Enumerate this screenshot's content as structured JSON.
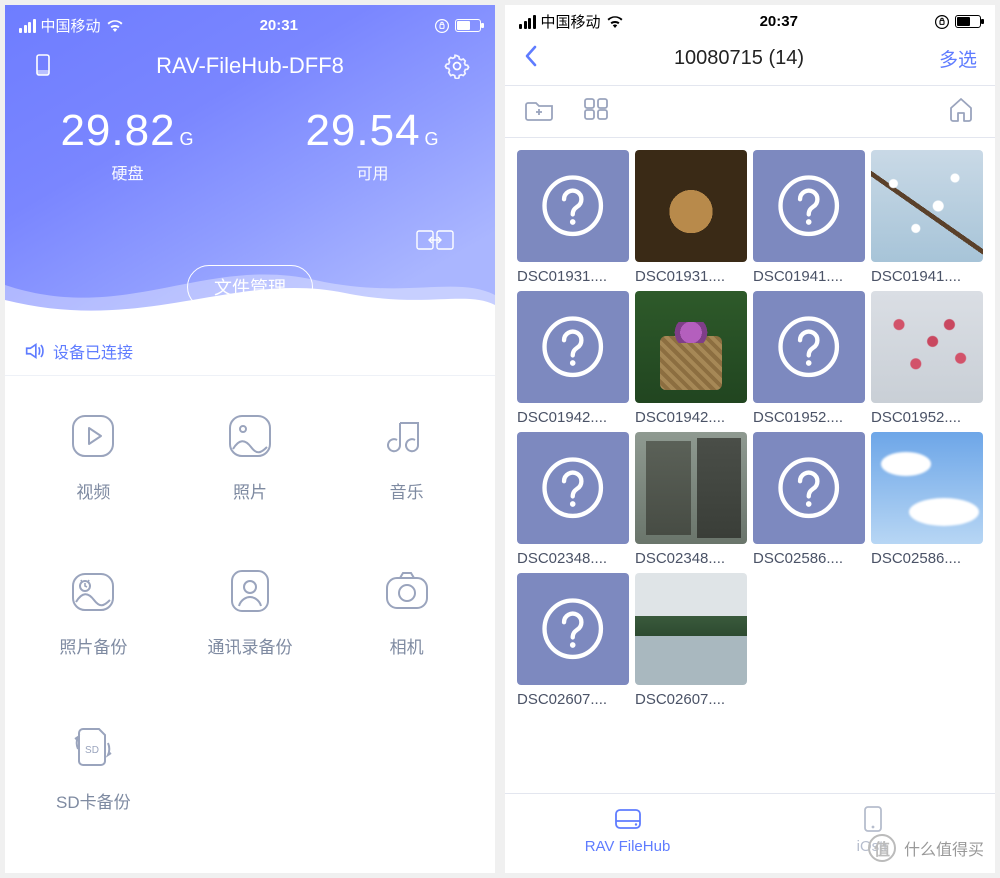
{
  "left": {
    "status": {
      "carrier": "中国移动",
      "time": "20:31"
    },
    "header": {
      "title": "RAV-FileHub-DFF8"
    },
    "storage": {
      "total_val": "29.82",
      "total_unit": "G",
      "total_label": "硬盘",
      "free_val": "29.54",
      "free_unit": "G",
      "free_label": "可用"
    },
    "file_mgmt_label": "文件管理",
    "connected_label": "设备已连接",
    "features": [
      {
        "id": "video",
        "label": "视频"
      },
      {
        "id": "photo",
        "label": "照片"
      },
      {
        "id": "music",
        "label": "音乐"
      },
      {
        "id": "pbackup",
        "label": "照片备份"
      },
      {
        "id": "cbackup",
        "label": "通讯录备份"
      },
      {
        "id": "camera",
        "label": "相机"
      },
      {
        "id": "sd",
        "label": "SD卡备份"
      }
    ]
  },
  "right": {
    "status": {
      "carrier": "中国移动",
      "time": "20:37"
    },
    "nav": {
      "title": "10080715 (14)",
      "action": "多选"
    },
    "files": [
      {
        "name": "DSC01931....",
        "thumb": "unknown"
      },
      {
        "name": "DSC01931....",
        "thumb": "statue"
      },
      {
        "name": "DSC01941....",
        "thumb": "unknown"
      },
      {
        "name": "DSC01941....",
        "thumb": "blossom"
      },
      {
        "name": "DSC01942....",
        "thumb": "unknown"
      },
      {
        "name": "DSC01942....",
        "thumb": "basket"
      },
      {
        "name": "DSC01952....",
        "thumb": "unknown"
      },
      {
        "name": "DSC01952....",
        "thumb": "pinkblossom"
      },
      {
        "name": "DSC02348....",
        "thumb": "unknown"
      },
      {
        "name": "DSC02348....",
        "thumb": "town"
      },
      {
        "name": "DSC02586....",
        "thumb": "unknown"
      },
      {
        "name": "DSC02586....",
        "thumb": "sky"
      },
      {
        "name": "DSC02607....",
        "thumb": "unknown"
      },
      {
        "name": "DSC02607....",
        "thumb": "lake"
      }
    ],
    "tabs": {
      "hub": "RAV FileHub",
      "mobile": "iOstr"
    }
  },
  "watermark": "什么值得买"
}
